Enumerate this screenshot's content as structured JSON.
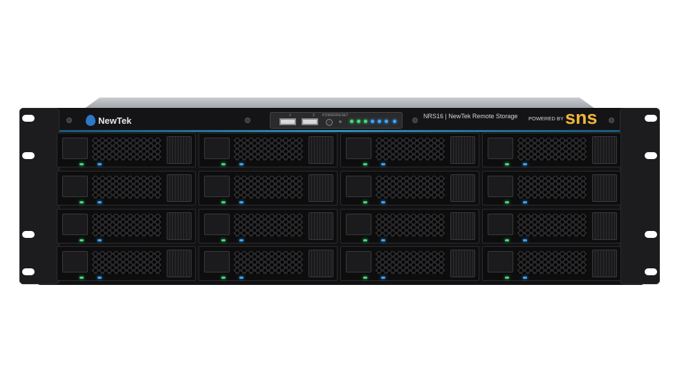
{
  "brand": {
    "logo_text": "NewTek"
  },
  "control_panel": {
    "usb_labels": [
      "1",
      "2"
    ],
    "power_label": "POWER",
    "reset_label": "RESET",
    "led_colors": [
      "#3fe07a",
      "#3fe07a",
      "#3fe07a",
      "#3aa8ff",
      "#3aa8ff",
      "#3aa8ff",
      "#3aa8ff"
    ]
  },
  "product": {
    "model": "NRS16 | NewTek Remote Storage",
    "powered_by": "POWERED BY",
    "partner_logo": "sns"
  },
  "drive_bays": {
    "rows": 4,
    "columns": 4,
    "status_led_colors": {
      "activity": "#3fe07a",
      "status": "#3aa8ff"
    }
  },
  "colors": {
    "chassis": "#121214",
    "accent_stripe": "#2f8fb8",
    "partner_brand": "#f2b63a"
  }
}
